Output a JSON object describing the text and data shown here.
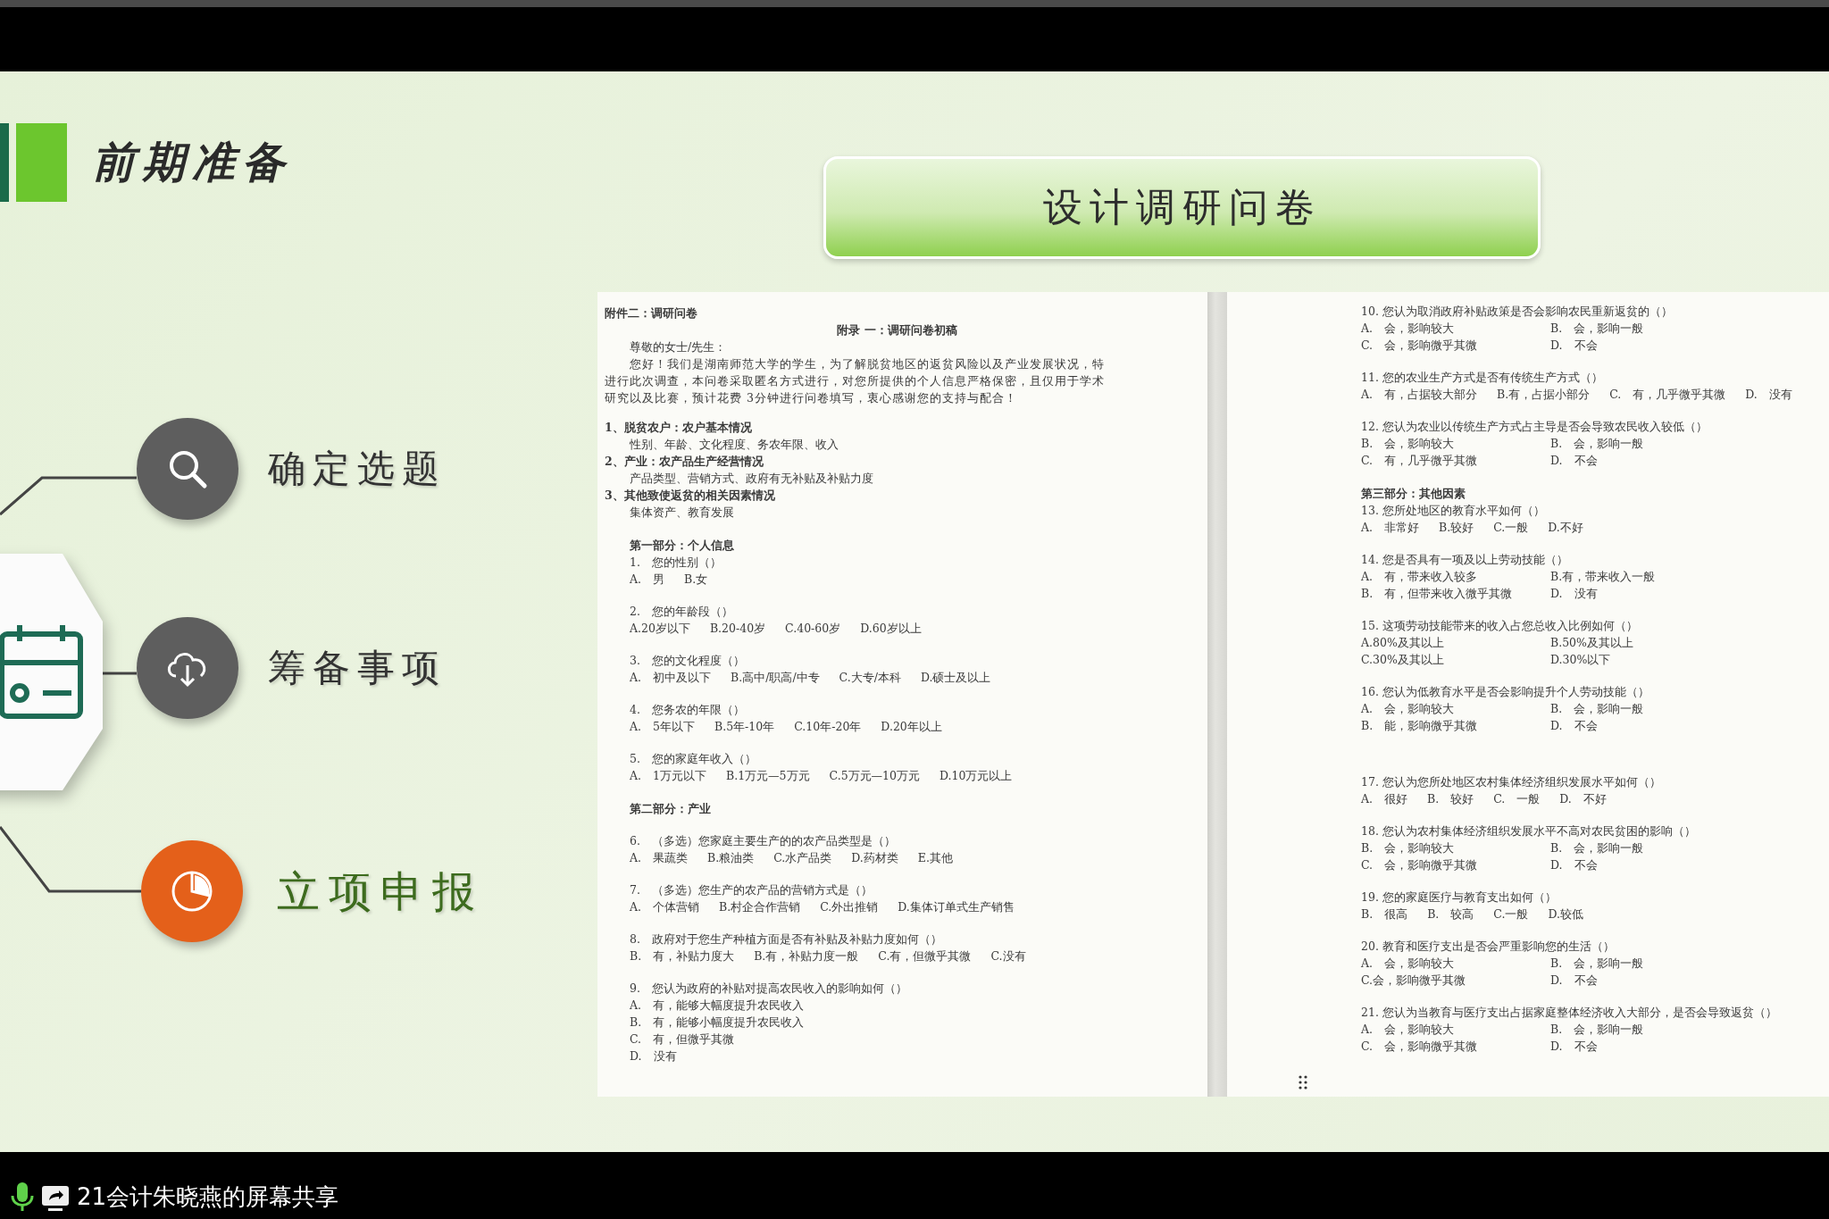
{
  "slide": {
    "title": "前期准备",
    "banner": "设计调研问卷",
    "steps": [
      {
        "label": "确定选题",
        "selected": false
      },
      {
        "label": "筹备事项",
        "selected": false
      },
      {
        "label": "立项申报",
        "selected": true
      }
    ],
    "document": {
      "pages": [
        {
          "blocks": [
            {
              "kind": "heading",
              "text": "附件二：调研问卷"
            },
            {
              "kind": "title",
              "text": "附录 一：调研问卷初稿"
            },
            {
              "kind": "text",
              "text": "尊敬的女士/先生："
            },
            {
              "kind": "para",
              "text": "您好！我们是湖南师范大学的学生，为了解脱贫地区的返贫风险以及产业发展状况，特进行此次调查，本问卷采取匿名方式进行，对您所提供的个人信息严格保密，且仅用于学术研究以及比赛，预计花费 3分钟进行问卷填写，衷心感谢您的支持与配合！"
            },
            {
              "kind": "topic",
              "text": "1、脱贫农户：农户基本情况"
            },
            {
              "kind": "text",
              "text": "性别、年龄、文化程度、务农年限、收入"
            },
            {
              "kind": "topic",
              "text": "2、产业：农产品生产经营情况"
            },
            {
              "kind": "text",
              "text": "产品类型、营销方式、政府有无补贴及补贴力度"
            },
            {
              "kind": "topic",
              "text": "3、其他致使返贫的相关因素情况"
            },
            {
              "kind": "text",
              "text": "集体资产、教育发展"
            },
            {
              "kind": "section",
              "text": "第一部分：个人信息"
            },
            {
              "kind": "text",
              "text": "1.　您的性别（）"
            },
            {
              "kind": "options",
              "options": [
                "A.　男",
                "B.女"
              ]
            },
            {
              "kind": "question",
              "text": "2.　您的年龄段（）"
            },
            {
              "kind": "options",
              "options": [
                "A.20岁以下",
                "B.20-40岁",
                "C.40-60岁",
                "D.60岁以上"
              ]
            },
            {
              "kind": "question",
              "text": "3.　您的文化程度（）"
            },
            {
              "kind": "options",
              "options": [
                "A.　初中及以下",
                "B.高中/职高/中专",
                "C.大专/本科",
                "D.硕士及以上"
              ]
            },
            {
              "kind": "question",
              "text": "4.　您务农的年限（）"
            },
            {
              "kind": "options",
              "options": [
                "A.　5年以下",
                "B.5年-10年",
                "C.10年-20年",
                "D.20年以上"
              ]
            },
            {
              "kind": "question",
              "text": "5.　您的家庭年收入（）"
            },
            {
              "kind": "options",
              "options": [
                "A.　1万元以下",
                "B.1万元—5万元",
                "C.5万元—10万元",
                "D.10万元以上"
              ]
            },
            {
              "kind": "section",
              "text": "第二部分：产业"
            },
            {
              "kind": "question",
              "text": "6.　（多选）您家庭主要生产的的农产品类型是（）"
            },
            {
              "kind": "options",
              "options": [
                "A.　果蔬类",
                "B.粮油类",
                "C.水产品类",
                "D.药材类",
                "E.其他"
              ]
            },
            {
              "kind": "question",
              "text": "7.　（多选）您生产的农产品的营销方式是（）"
            },
            {
              "kind": "options",
              "options": [
                "A.　个体营销",
                "B.村企合作营销",
                "C.外出推销",
                "D.集体订单式生产销售"
              ]
            },
            {
              "kind": "question",
              "text": "8.　政府对于您生产种植方面是否有补贴及补贴力度如何（）"
            },
            {
              "kind": "options",
              "options": [
                "B.　有，补贴力度大",
                "B.有，补贴力度一般",
                "C.有，但微乎其微",
                "C.没有"
              ]
            },
            {
              "kind": "question",
              "text": "9.　您认为政府的补贴对提高农民收入的影响如何（）"
            },
            {
              "kind": "options",
              "options": [
                "A.　有，能够大幅度提升农民收入"
              ]
            },
            {
              "kind": "options",
              "options": [
                "B.　有，能够小幅度提升农民收入"
              ]
            },
            {
              "kind": "options",
              "options": [
                "C.　有，但微乎其微"
              ]
            },
            {
              "kind": "options",
              "options": [
                "D.　没有"
              ]
            }
          ]
        },
        {
          "blocks": [
            {
              "kind": "text",
              "text": "10. 您认为取消政府补贴政策是否会影响农民重新返贫的（）"
            },
            {
              "kind": "options",
              "options": [
                "A.　会，影响较大",
                "B.　会，影响一般"
              ]
            },
            {
              "kind": "options",
              "options": [
                "C.　会，影响微乎其微",
                "D.　不会"
              ]
            },
            {
              "kind": "question",
              "text": "11. 您的农业生产方式是否有传统生产方式（）"
            },
            {
              "kind": "options",
              "options": [
                "A.　有，占据较大部分",
                "B.有，占据小部分",
                "C.　有，几乎微乎其微",
                "D.　没有"
              ]
            },
            {
              "kind": "question",
              "text": "12. 您认为农业以传统生产方式占主导是否会导致农民收入较低（）"
            },
            {
              "kind": "options",
              "options": [
                "B.　会，影响较大",
                "B.　会，影响一般"
              ]
            },
            {
              "kind": "options",
              "options": [
                "C.　有，几乎微乎其微",
                "D.　不会"
              ]
            },
            {
              "kind": "section",
              "text": "第三部分：其他因素"
            },
            {
              "kind": "text",
              "text": "13. 您所处地区的教育水平如何（）"
            },
            {
              "kind": "options",
              "options": [
                "A.　非常好",
                "B.较好",
                "C.一般",
                "D.不好"
              ]
            },
            {
              "kind": "question",
              "text": "14. 您是否具有一项及以上劳动技能（）"
            },
            {
              "kind": "options",
              "options": [
                "A.　有，带来收入较多",
                "B.有，带来收入一般"
              ]
            },
            {
              "kind": "options",
              "options": [
                "B.　有，但带来收入微乎其微",
                "D.　没有"
              ]
            },
            {
              "kind": "question",
              "text": "15. 这项劳动技能带来的收入占您总收入比例如何（）"
            },
            {
              "kind": "options",
              "options": [
                "A.80%及其以上",
                "B.50%及其以上"
              ]
            },
            {
              "kind": "options",
              "options": [
                "C.30%及其以上",
                "D.30%以下"
              ]
            },
            {
              "kind": "question",
              "text": "16. 您认为低教育水平是否会影响提升个人劳动技能（）"
            },
            {
              "kind": "options",
              "options": [
                "A.　会，影响较大",
                "B.　会，影响一般"
              ]
            },
            {
              "kind": "options",
              "options": [
                "B.　能，影响微乎其微",
                "D.　不会"
              ]
            },
            {
              "kind": "spaced",
              "text": "17. 您认为您所处地区农村集体经济组织发展水平如何（）"
            },
            {
              "kind": "options",
              "options": [
                "A.　很好",
                "B.　较好",
                "C.　一般",
                "D.　不好"
              ]
            },
            {
              "kind": "question",
              "text": "18. 您认为农村集体经济组织发展水平不高对农民贫困的影响（）"
            },
            {
              "kind": "options",
              "options": [
                "B.　会，影响较大",
                "B.　会，影响一般"
              ]
            },
            {
              "kind": "options",
              "options": [
                "C.　会，影响微乎其微",
                "D.　不会"
              ]
            },
            {
              "kind": "question",
              "text": "19. 您的家庭医疗与教育支出如何（）"
            },
            {
              "kind": "options",
              "options": [
                "B.　很高",
                "B.　较高",
                "C.一般",
                "D.较低"
              ]
            },
            {
              "kind": "question",
              "text": "20. 教育和医疗支出是否会严重影响您的生活（）"
            },
            {
              "kind": "options",
              "options": [
                "A.　会，影响较大",
                "B.　会，影响一般"
              ]
            },
            {
              "kind": "options",
              "options": [
                "C.会，影响微乎其微",
                "D.　不会"
              ]
            },
            {
              "kind": "question",
              "text": "21. 您认为当教育与医疗支出占据家庭整体经济收入大部分，是否会导致返贫（）"
            },
            {
              "kind": "options",
              "options": [
                "A.　会，影响较大",
                "B.　会，影响一般"
              ]
            },
            {
              "kind": "options",
              "options": [
                "C.　会，影响微乎其微",
                "D.　不会"
              ]
            }
          ]
        }
      ]
    }
  },
  "share_bar": {
    "label": "21会计朱晓燕的屏幕共享"
  }
}
